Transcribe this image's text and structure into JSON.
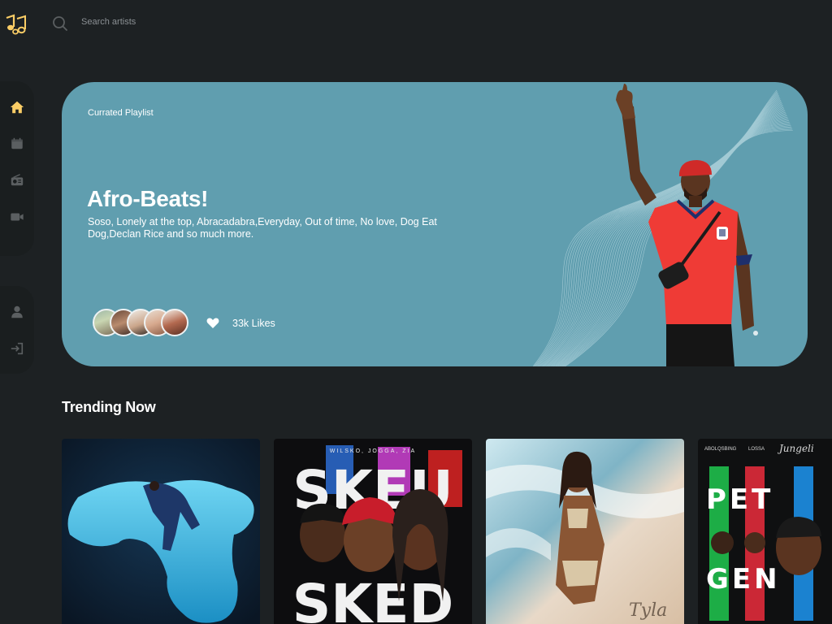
{
  "search": {
    "placeholder": "Search artists"
  },
  "sidebar": {
    "top_items": [
      {
        "icon": "home-icon",
        "active": true
      },
      {
        "icon": "playlist-icon",
        "active": false
      },
      {
        "icon": "radio-icon",
        "active": false
      },
      {
        "icon": "video-icon",
        "active": false
      }
    ],
    "bottom_items": [
      {
        "icon": "profile-icon"
      },
      {
        "icon": "logout-icon"
      }
    ]
  },
  "hero": {
    "eyebrow": "Currated Playlist",
    "title": "Afro-Beats!",
    "description": "Soso, Lonely at the top, Abracadabra,Everyday, Out of time, No love, Dog Eat Dog,Declan Rice and so much more.",
    "likes": "33k Likes",
    "background_color": "#609eaf"
  },
  "trending": {
    "title": "Trending Now",
    "cards": [
      {
        "name": "album-cover-1"
      },
      {
        "name": "album-cover-2",
        "cover_text": [
          "WILSKO, JOGGA, ZIA",
          "SKEU",
          "SKED"
        ]
      },
      {
        "name": "album-cover-3",
        "cover_text": [
          "Tyla"
        ]
      },
      {
        "name": "album-cover-4",
        "cover_text": [
          "ABOLQSBING",
          "LOSSA",
          "Jungeli",
          "PET",
          "GEN"
        ]
      }
    ]
  },
  "colors": {
    "background": "#1d2123",
    "sidebar": "#1a1e1f",
    "accent": "#facd66",
    "icon_muted": "#5b5f61"
  }
}
